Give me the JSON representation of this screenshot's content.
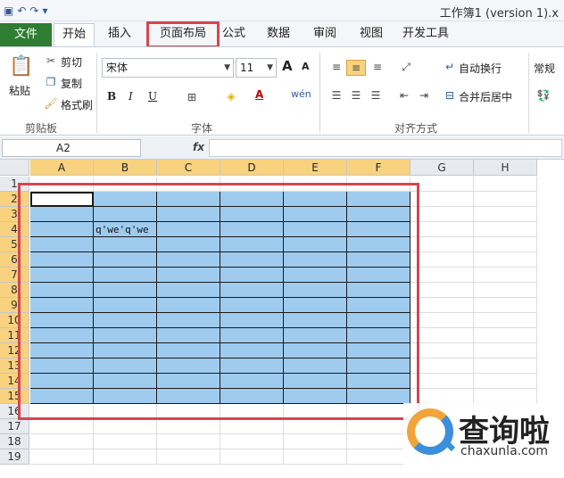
{
  "titlebar": {
    "save_icon": "save-icon",
    "undo_icon": "undo-icon",
    "redo_icon": "redo-icon",
    "title": "工作簿1 (version 1).x"
  },
  "ribbon_tabs": [
    "文件",
    "开始",
    "插入",
    "页面布局",
    "公式",
    "数据",
    "审阅",
    "视图",
    "开发工具"
  ],
  "clipboard": {
    "paste": "粘贴",
    "cut": "剪切",
    "copy": "复制",
    "format_painter": "格式刷",
    "group_label": "剪贴板"
  },
  "font": {
    "name": "宋体",
    "size": "11",
    "bold": "B",
    "italic": "I",
    "underline": "U",
    "grow": "A",
    "shrink": "A",
    "font_color_letter": "A",
    "phonetic": "wén",
    "group_label": "字体"
  },
  "alignment": {
    "wrap": "自动换行",
    "merge": "合并后居中",
    "group_label": "对齐方式"
  },
  "number": {
    "format": "常规"
  },
  "formula_bar": {
    "name_box": "A2",
    "fx": "fx",
    "content": ""
  },
  "sheet": {
    "columns": [
      "A",
      "B",
      "C",
      "D",
      "E",
      "F",
      "G",
      "H"
    ],
    "rows": [
      "1",
      "2",
      "3",
      "4",
      "5",
      "6",
      "7",
      "8",
      "9",
      "10",
      "11",
      "12",
      "13",
      "14",
      "15",
      "16",
      "17",
      "18",
      "19"
    ],
    "cell_b4": "q'we'q'we",
    "fill_color": "#9fcbef"
  },
  "colors": {
    "file_tab": "#2e7d32",
    "highlight_red": "#d64550",
    "header_selected": "#f9d27f"
  },
  "watermark": {
    "cn": "查询啦",
    "en": "chaxunla.com"
  }
}
